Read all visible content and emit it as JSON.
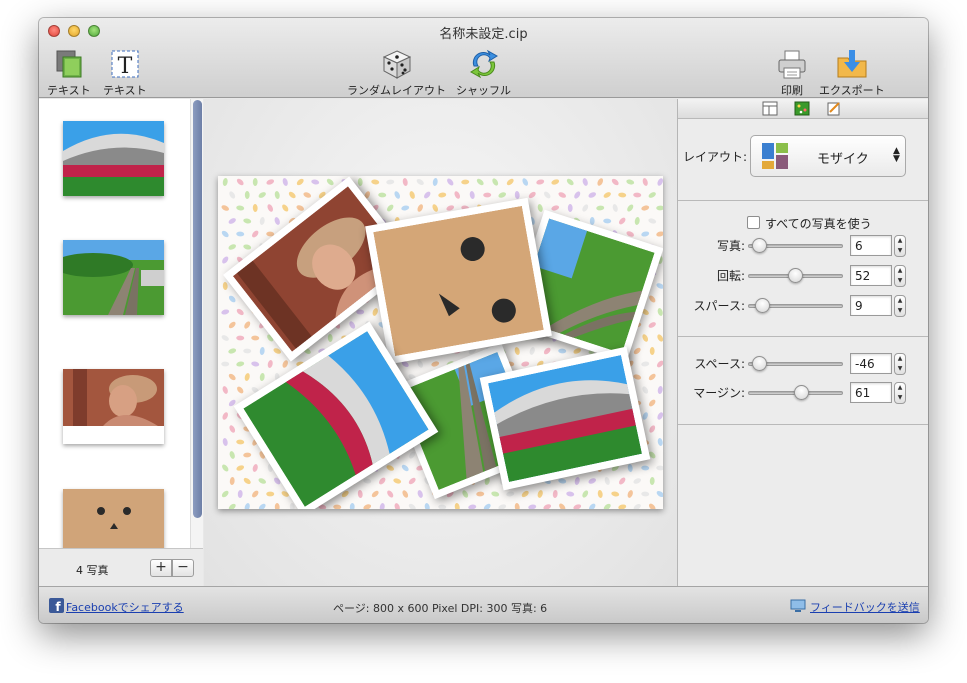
{
  "window": {
    "title": "名称未設定.cip"
  },
  "toolbar": {
    "text_tool_1": "テキスト",
    "text_tool_2": "テキスト",
    "random_layout": "ランダムレイアウト",
    "shuffle": "シャッフル",
    "print": "印刷",
    "export": "エクスポート"
  },
  "sidebar": {
    "photo_count": "4 写真",
    "add_label": "+",
    "remove_label": "−",
    "thumbnails": [
      "stadium-photo",
      "railway-photo",
      "woman-hat-photo",
      "cardboard-box-photo"
    ]
  },
  "inspector": {
    "layout_label": "レイアウト:",
    "layout_value": "モザイク",
    "use_all_photos": "すべての写真を使う",
    "photos_label": "写真:",
    "photos_value": "6",
    "photos_level": 0.05,
    "rotation_label": "回転:",
    "rotation_value": "52",
    "rotation_level": 0.5,
    "sparse_label": "スパース:",
    "sparse_value": "9",
    "sparse_level": 0.09,
    "space_label": "スペース:",
    "space_value": "-46",
    "space_level": 0.05,
    "margin_label": "マージン:",
    "margin_value": "61",
    "margin_level": 0.58
  },
  "status": {
    "facebook_share": "Facebookでシェアする",
    "page_info": "ページ: 800 x 600 Pixel  DPI: 300 写真: 6",
    "feedback": "フィードバックを送信"
  },
  "colors": {
    "accent": "#1a3fb0",
    "scroll_thumb": "#6d7fa7"
  }
}
